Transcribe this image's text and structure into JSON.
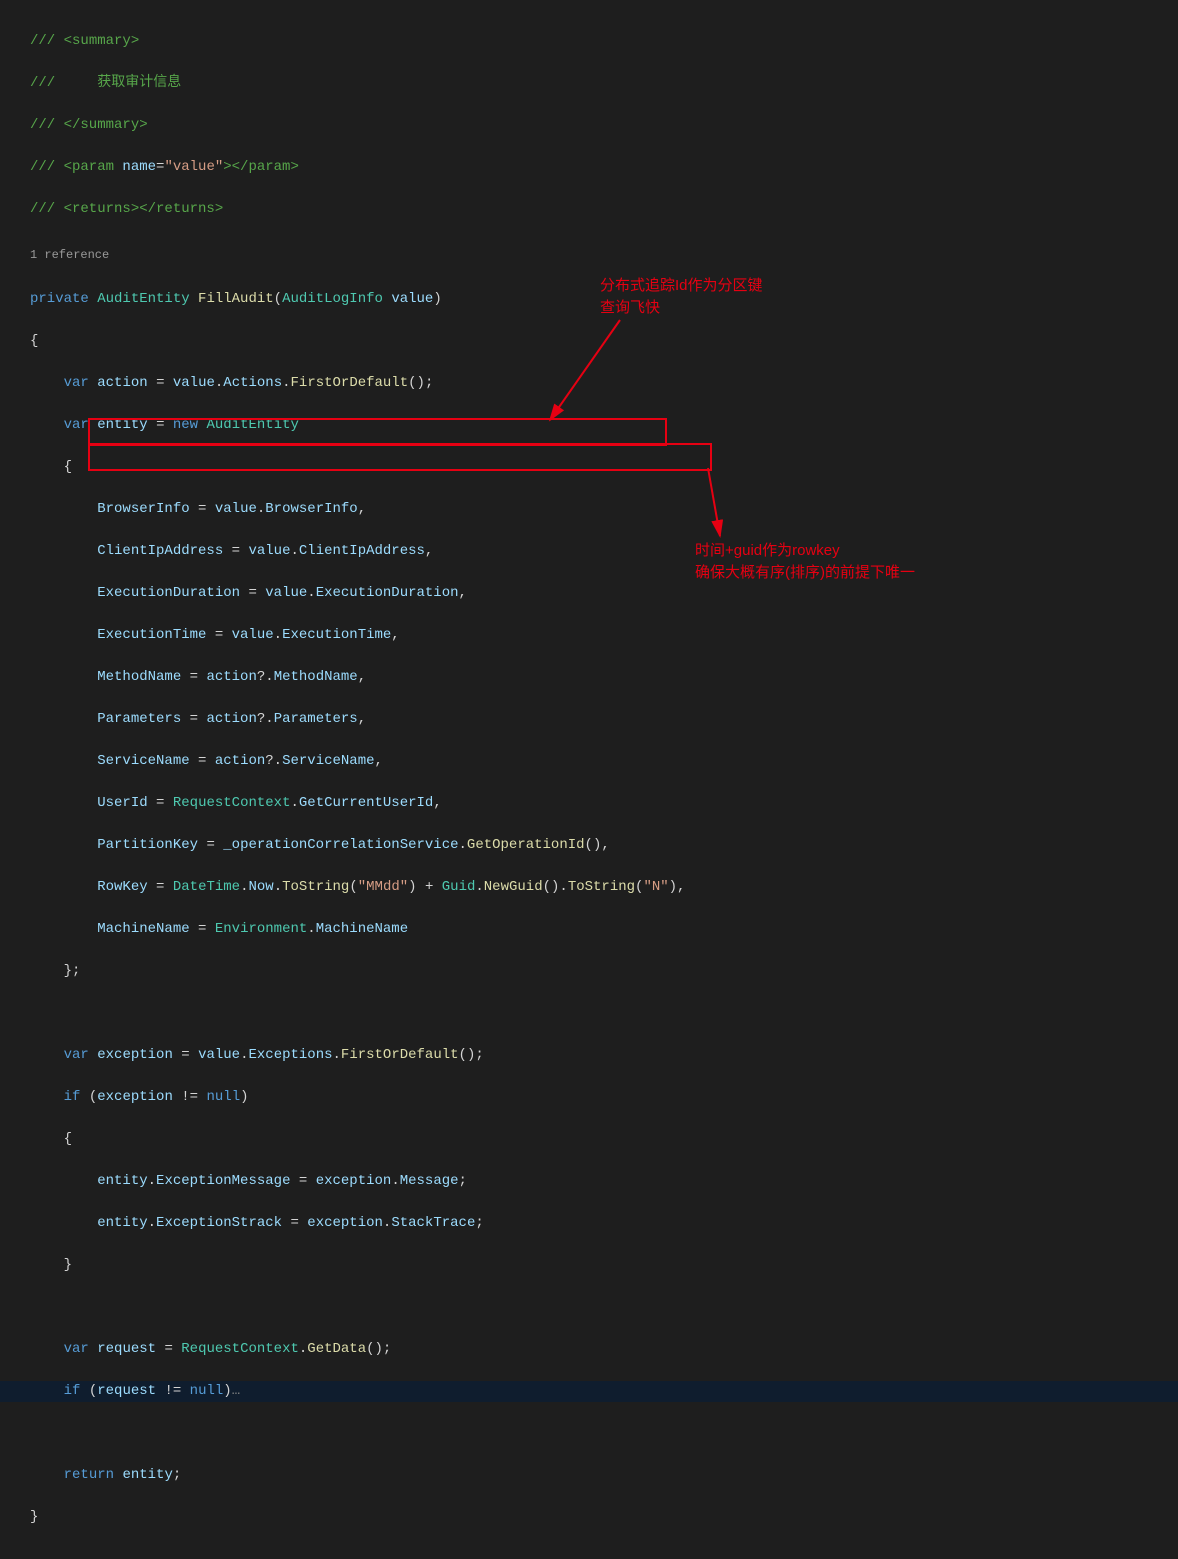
{
  "code": {
    "summary_open": "/// <summary>",
    "summary_text": "///     获取审计信息",
    "summary_close": "/// </summary>",
    "param_tag": "/// <param name=\"value\"></param>",
    "returns_tag": "/// <returns></returns>",
    "codelens": "1 reference",
    "signature": {
      "access": "private",
      "ret_type": "AuditEntity",
      "method": "FillAudit",
      "param_type": "AuditLogInfo",
      "param_name": "value"
    },
    "l_brace_open": "{",
    "action_decl": {
      "kw": "var",
      "name": "action",
      "rhs_obj": "value",
      "rhs_mem": "Actions",
      "rhs_call": "FirstOrDefault"
    },
    "entity_decl": {
      "kw": "var",
      "name": "entity",
      "new_kw": "new",
      "ctor": "AuditEntity"
    },
    "init": {
      "BrowserInfo": {
        "lhs": "BrowserInfo",
        "rhs": "value.BrowserInfo"
      },
      "ClientIpAddress": {
        "lhs": "ClientIpAddress",
        "rhs": "value.ClientIpAddress"
      },
      "ExecutionDuration": {
        "lhs": "ExecutionDuration",
        "rhs": "value.ExecutionDuration"
      },
      "ExecutionTime": {
        "lhs": "ExecutionTime",
        "rhs": "value.ExecutionTime"
      },
      "MethodName": {
        "lhs": "MethodName",
        "rhs": "action?.MethodName"
      },
      "Parameters": {
        "lhs": "Parameters",
        "rhs": "action?.Parameters"
      },
      "ServiceName": {
        "lhs": "ServiceName",
        "rhs": "action?.ServiceName"
      },
      "UserId": {
        "lhs": "UserId",
        "rhs": "RequestContext.GetCurrentUserId"
      },
      "PartitionKey": {
        "lhs": "PartitionKey",
        "rhs1": "_operationCorrelationService",
        "rhs_call": "GetOperationId"
      },
      "RowKey": {
        "lhs": "RowKey",
        "dt": "DateTime",
        "now": "Now",
        "tostr": "ToString",
        "mmdd": "\"MMdd\"",
        "guid": "Guid",
        "newguid": "NewGuid",
        "n": "\"N\""
      },
      "MachineName": {
        "lhs": "MachineName",
        "rhs_cls": "Environment",
        "rhs_mem": "MachineName"
      }
    },
    "exception_decl": {
      "kw": "var",
      "name": "exception",
      "rhs": "value.Exceptions.FirstOrDefault()"
    },
    "if_exc": {
      "kw": "if",
      "cond_name": "exception",
      "null_kw": "null"
    },
    "exc_msg": "entity.ExceptionMessage = exception.Message;",
    "exc_stack": "entity.ExceptionStrack = exception.StackTrace;",
    "request_decl": {
      "kw": "var",
      "name": "request",
      "cls": "RequestContext",
      "call": "GetData"
    },
    "if_req": {
      "kw": "if",
      "cond_name": "request",
      "null_kw": "null",
      "collapsed": "…"
    },
    "return_stmt": {
      "kw": "return",
      "name": "entity"
    },
    "rbrace": "}"
  },
  "annotations": {
    "box1_note_l1": "分布式追踪Id作为分区键",
    "box1_note_l2": "查询飞快",
    "box2_note_l1": "时间+guid作为rowkey",
    "box2_note_l2": "确保大概有序(排序)的前提下唯一"
  }
}
